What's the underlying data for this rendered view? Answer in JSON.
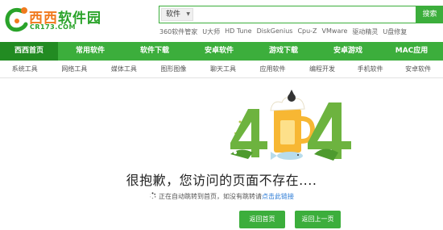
{
  "logo": {
    "title_a": "西西",
    "title_b": "软件园",
    "url": "CR173.COM"
  },
  "search": {
    "category": "软件",
    "placeholder": "",
    "value": "",
    "button": "搜索"
  },
  "hot_links": [
    "360软件管家",
    "U大师",
    "HD Tune",
    "DiskGenius",
    "Cpu-Z",
    "VMware",
    "驱动精灵",
    "U盘修复"
  ],
  "main_nav": [
    "西西首页",
    "常用软件",
    "软件下载",
    "安卓软件",
    "游戏下载",
    "安卓游戏",
    "MAC应用"
  ],
  "sub_nav": [
    "系统工具",
    "网络工具",
    "媒体工具",
    "图形图像",
    "聊天工具",
    "应用软件",
    "编程开发",
    "手机软件",
    "安卓软件"
  ],
  "error": {
    "title": "很抱歉，您访问的页面不存在....",
    "redirect_text": "正在自动跳转到首页，如没有跳转请",
    "redirect_link": "点击此链接"
  },
  "buttons": {
    "home": "返回首页",
    "back": "返回上一页"
  },
  "colors": {
    "brand_green": "#3cae3c",
    "nav_active": "#228b22",
    "link_blue": "#2a7ad6",
    "logo_orange": "#f07a1e"
  }
}
